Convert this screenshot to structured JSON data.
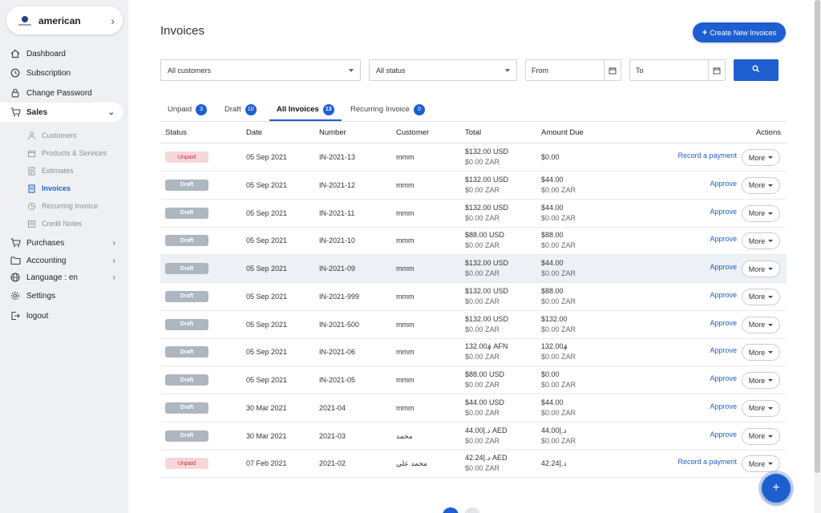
{
  "org": {
    "name": "american"
  },
  "nav": {
    "dashboard": "Dashboard",
    "subscription": "Subscription",
    "change_password": "Change Password",
    "sales": "Sales",
    "sales_sub": {
      "customers": "Customers",
      "products": "Products & Services",
      "estimates": "Estimates",
      "invoices": "Invoices",
      "recurring": "Recurring Invoice",
      "credit_notes": "Credit Notes"
    },
    "purchases": "Purchases",
    "accounting": "Accounting",
    "language": "Language : en",
    "settings": "Settings",
    "logout": "logout"
  },
  "page": {
    "title": "Invoices",
    "create_label": "Create New Invoices"
  },
  "filters": {
    "customer": "All customers",
    "status": "All status",
    "from": "From",
    "to": "To"
  },
  "tabs": [
    {
      "label": "Unpaid",
      "count": "3"
    },
    {
      "label": "Draft",
      "count": "10"
    },
    {
      "label": "All Invoices",
      "count": "13"
    },
    {
      "label": "Recurring Invoice",
      "count": "0"
    }
  ],
  "table": {
    "headers": {
      "status": "Status",
      "date": "Date",
      "number": "Number",
      "customer": "Customer",
      "total": "Total",
      "amount_due": "Amount Due",
      "actions": "Actions"
    },
    "more_label": "More",
    "rows": [
      {
        "status": "Unpaid",
        "date": "05 Sep 2021",
        "number": "IN-2021-13",
        "customer": "mmm",
        "total": "$132.00 USD",
        "total_sub": "$0.00 ZAR",
        "due": "$0.00",
        "due_sub": "",
        "action": "Record a payment"
      },
      {
        "status": "Draft",
        "date": "05 Sep 2021",
        "number": "IN-2021-12",
        "customer": "mmm",
        "total": "$132.00 USD",
        "total_sub": "$0.00 ZAR",
        "due": "$44.00",
        "due_sub": "$0.00 ZAR",
        "action": "Approve"
      },
      {
        "status": "Draft",
        "date": "05 Sep 2021",
        "number": "IN-2021-11",
        "customer": "mmm",
        "total": "$132.00 USD",
        "total_sub": "$0.00 ZAR",
        "due": "$44.00",
        "due_sub": "$0.00 ZAR",
        "action": "Approve"
      },
      {
        "status": "Draft",
        "date": "05 Sep 2021",
        "number": "IN-2021-10",
        "customer": "mmm",
        "total": "$88.00 USD",
        "total_sub": "$0.00 ZAR",
        "due": "$88.00",
        "due_sub": "$0.00 ZAR",
        "action": "Approve"
      },
      {
        "status": "Draft",
        "date": "05 Sep 2021",
        "number": "IN-2021-09",
        "customer": "mmm",
        "total": "$132.00 USD",
        "total_sub": "$0.00 ZAR",
        "due": "$44.00",
        "due_sub": "$0.00 ZAR",
        "action": "Approve"
      },
      {
        "status": "Draft",
        "date": "05 Sep 2021",
        "number": "IN-2021-999",
        "customer": "mmm",
        "total": "$132.00 USD",
        "total_sub": "$0.00 ZAR",
        "due": "$88.00",
        "due_sub": "$0.00 ZAR",
        "action": "Approve"
      },
      {
        "status": "Draft",
        "date": "05 Sep 2021",
        "number": "IN-2021-500",
        "customer": "mmm",
        "total": "$132.00 USD",
        "total_sub": "$0.00 ZAR",
        "due": "$132.00",
        "due_sub": "$0.00 ZAR",
        "action": "Approve"
      },
      {
        "status": "Draft",
        "date": "05 Sep 2021",
        "number": "IN-2021-06",
        "customer": "mmm",
        "total": "132.00؋ AFN",
        "total_sub": "$0.00 ZAR",
        "due": "132.00؋",
        "due_sub": "$0.00 ZAR",
        "action": "Approve"
      },
      {
        "status": "Draft",
        "date": "05 Sep 2021",
        "number": "IN-2021-05",
        "customer": "mmm",
        "total": "$88.00 USD",
        "total_sub": "$0.00 ZAR",
        "due": "$0.00",
        "due_sub": "$0.00 ZAR",
        "action": "Approve"
      },
      {
        "status": "Draft",
        "date": "30 Mar 2021",
        "number": "2021-04",
        "customer": "mmm",
        "total": "$44.00 USD",
        "total_sub": "$0.00 ZAR",
        "due": "$44.00",
        "due_sub": "$0.00 ZAR",
        "action": "Approve"
      },
      {
        "status": "Draft",
        "date": "30 Mar 2021",
        "number": "2021-03",
        "customer": "محمد",
        "total": "44.00د.إ AED",
        "total_sub": "$0.00 ZAR",
        "due": "44.00د.إ",
        "due_sub": "$0.00 ZAR",
        "action": "Approve"
      },
      {
        "status": "Unpaid",
        "date": "07 Feb 2021",
        "number": "2021-02",
        "customer": "محمد علي",
        "total": "42.24د.إ AED",
        "total_sub": "$0.00 ZAR",
        "due": "42.24د.إ",
        "due_sub": "",
        "action": "Record a payment"
      }
    ]
  },
  "colors": {
    "accent": "#1d5fd1",
    "draft": "#aeb6bf",
    "unpaid_bg": "#f6d6d8",
    "unpaid_text": "#c4313b"
  },
  "icons": {
    "fab": "plus-icon",
    "search": "search-icon",
    "calendar": "calendar-icon"
  }
}
